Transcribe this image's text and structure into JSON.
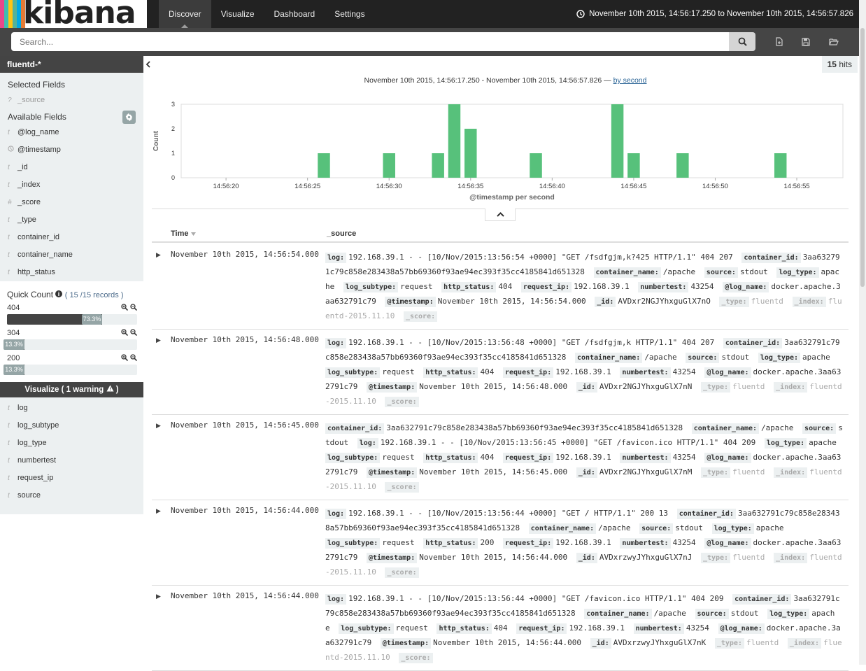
{
  "app": {
    "logo_text": "kibana",
    "logo_colors": [
      "#e8488b",
      "#3ebeb0",
      "#fec514",
      "#54b399",
      "#00a9e5",
      "#e57b36"
    ]
  },
  "nav": {
    "tabs": [
      {
        "label": "Discover",
        "active": true
      },
      {
        "label": "Visualize"
      },
      {
        "label": "Dashboard"
      },
      {
        "label": "Settings"
      }
    ]
  },
  "timerange": {
    "label": "November 10th 2015, 14:56:17.250 to November 10th 2015, 14:56:57.826"
  },
  "search": {
    "placeholder": "Search..."
  },
  "sidebar": {
    "index_pattern": "fluentd-*",
    "selected_title": "Selected Fields",
    "selected_fields": [
      {
        "type": "?",
        "name": "_source"
      }
    ],
    "available_title": "Available Fields",
    "fields_top": [
      {
        "type": "t",
        "name": "@log_name"
      },
      {
        "type": "clock",
        "name": "@timestamp"
      },
      {
        "type": "t",
        "name": "_id"
      },
      {
        "type": "t",
        "name": "_index"
      },
      {
        "type": "#",
        "name": "_score"
      },
      {
        "type": "t",
        "name": "_type"
      },
      {
        "type": "t",
        "name": "container_id"
      },
      {
        "type": "t",
        "name": "container_name"
      },
      {
        "type": "t",
        "name": "http_status"
      }
    ],
    "quick_count": {
      "title": "Quick Count",
      "count": "15",
      "total": "/15 records",
      "rows": [
        {
          "label": "404",
          "pct": "73.3%",
          "fraction": 0.733
        },
        {
          "label": "304",
          "pct": "13.3%",
          "fraction": 0.133
        },
        {
          "label": "200",
          "pct": "13.3%",
          "fraction": 0.133
        }
      ]
    },
    "visualize_btn": "Visualize ( 1 warning",
    "fields_bottom": [
      {
        "type": "t",
        "name": "log"
      },
      {
        "type": "t",
        "name": "log_subtype"
      },
      {
        "type": "t",
        "name": "log_type"
      },
      {
        "type": "t",
        "name": "numbertest"
      },
      {
        "type": "t",
        "name": "request_ip"
      },
      {
        "type": "t",
        "name": "source"
      }
    ]
  },
  "hits": {
    "count": "15",
    "label": "hits"
  },
  "chart_range": {
    "text": "November 10th 2015, 14:56:17.250 - November 10th 2015, 14:56:57.826 —",
    "link": "by second"
  },
  "chart_data": {
    "type": "bar",
    "xlabel": "@timestamp per second",
    "ylabel": "Count",
    "ylim": [
      0,
      3
    ],
    "yticks": [
      0,
      1,
      2,
      3
    ],
    "xticks": [
      {
        "label": "14:56:20",
        "t": 20
      },
      {
        "label": "14:56:25",
        "t": 25
      },
      {
        "label": "14:56:30",
        "t": 30
      },
      {
        "label": "14:56:35",
        "t": 35
      },
      {
        "label": "14:56:40",
        "t": 40
      },
      {
        "label": "14:56:45",
        "t": 45
      },
      {
        "label": "14:56:50",
        "t": 50
      },
      {
        "label": "14:56:55",
        "t": 55
      }
    ],
    "xlim": [
      17.25,
      57.83
    ],
    "bars": [
      {
        "t": 26,
        "v": 1
      },
      {
        "t": 30,
        "v": 1
      },
      {
        "t": 33,
        "v": 1
      },
      {
        "t": 34,
        "v": 3
      },
      {
        "t": 35,
        "v": 2
      },
      {
        "t": 39,
        "v": 1
      },
      {
        "t": 44,
        "v": 3
      },
      {
        "t": 45,
        "v": 1
      },
      {
        "t": 48,
        "v": 1
      },
      {
        "t": 54,
        "v": 1
      }
    ],
    "bar_color": "#57c17b"
  },
  "table": {
    "headers": {
      "time": "Time",
      "source": "_source"
    },
    "rows": [
      {
        "time": "November 10th 2015, 14:56:54.000",
        "fields": [
          [
            "log:",
            "192.168.39.1 - - [10/Nov/2015:13:56:54 +0000] \"GET /fsdfgjm,k?425 HTTP/1.1\" 404 207"
          ],
          [
            "container_id:",
            "3aa632791c79c858e283438a57bb69360f93ae94ec393f35cc4185841d651328"
          ],
          [
            "container_name:",
            "/apache"
          ],
          [
            "source:",
            "stdout"
          ],
          [
            "log_type:",
            "apache"
          ],
          [
            "log_subtype:",
            "request"
          ],
          [
            "http_status:",
            "404"
          ],
          [
            "request_ip:",
            "192.168.39.1"
          ],
          [
            "numbertest:",
            "43254"
          ],
          [
            "@log_name:",
            "docker.apache.3aa632791c79"
          ],
          [
            "@timestamp:",
            "November 10th 2015, 14:56:54.000"
          ],
          [
            "_id:",
            "AVDxr2NGJYhxguGlX7nO"
          ],
          [
            "_type:",
            "fluentd"
          ],
          [
            "_index:",
            "fluentd-2015.11.10"
          ],
          [
            "_score:",
            ""
          ]
        ]
      },
      {
        "time": "November 10th 2015, 14:56:48.000",
        "fields": [
          [
            "log:",
            "192.168.39.1 - - [10/Nov/2015:13:56:48 +0000] \"GET /fsdfgjm,k HTTP/1.1\" 404 207"
          ],
          [
            "container_id:",
            "3aa632791c79c858e283438a57bb69360f93ae94ec393f35cc4185841d651328"
          ],
          [
            "container_name:",
            "/apache"
          ],
          [
            "source:",
            "stdout"
          ],
          [
            "log_type:",
            "apache"
          ],
          [
            "log_subtype:",
            "request"
          ],
          [
            "http_status:",
            "404"
          ],
          [
            "request_ip:",
            "192.168.39.1"
          ],
          [
            "numbertest:",
            "43254"
          ],
          [
            "@log_name:",
            "docker.apache.3aa632791c79"
          ],
          [
            "@timestamp:",
            "November 10th 2015, 14:56:48.000"
          ],
          [
            "_id:",
            "AVDxr2NGJYhxguGlX7nN"
          ],
          [
            "_type:",
            "fluentd"
          ],
          [
            "_index:",
            "fluentd-2015.11.10"
          ],
          [
            "_score:",
            ""
          ]
        ]
      },
      {
        "time": "November 10th 2015, 14:56:45.000",
        "fields": [
          [
            "container_id:",
            "3aa632791c79c858e283438a57bb69360f93ae94ec393f35cc4185841d651328"
          ],
          [
            "container_name:",
            "/apache"
          ],
          [
            "source:",
            "stdout"
          ],
          [
            "log:",
            "192.168.39.1 - - [10/Nov/2015:13:56:45 +0000] \"GET /favicon.ico HTTP/1.1\" 404 209"
          ],
          [
            "log_type:",
            "apache"
          ],
          [
            "log_subtype:",
            "request"
          ],
          [
            "http_status:",
            "404"
          ],
          [
            "request_ip:",
            "192.168.39.1"
          ],
          [
            "numbertest:",
            "43254"
          ],
          [
            "@log_name:",
            "docker.apache.3aa632791c79"
          ],
          [
            "@timestamp:",
            "November 10th 2015, 14:56:45.000"
          ],
          [
            "_id:",
            "AVDxr2NGJYhxguGlX7nM"
          ],
          [
            "_type:",
            "fluentd"
          ],
          [
            "_index:",
            "fluentd-2015.11.10"
          ],
          [
            "_score:",
            ""
          ]
        ]
      },
      {
        "time": "November 10th 2015, 14:56:44.000",
        "fields": [
          [
            "log:",
            "192.168.39.1 - - [10/Nov/2015:13:56:44 +0000] \"GET / HTTP/1.1\" 200 13"
          ],
          [
            "container_id:",
            "3aa632791c79c858e283438a57bb69360f93ae94ec393f35cc4185841d651328"
          ],
          [
            "container_name:",
            "/apache"
          ],
          [
            "source:",
            "stdout"
          ],
          [
            "log_type:",
            "apache"
          ],
          [
            "log_subtype:",
            "request"
          ],
          [
            "http_status:",
            "200"
          ],
          [
            "request_ip:",
            "192.168.39.1"
          ],
          [
            "numbertest:",
            "43254"
          ],
          [
            "@log_name:",
            "docker.apache.3aa632791c79"
          ],
          [
            "@timestamp:",
            "November 10th 2015, 14:56:44.000"
          ],
          [
            "_id:",
            "AVDxrzwyJYhxguGlX7nJ"
          ],
          [
            "_type:",
            "fluentd"
          ],
          [
            "_index:",
            "fluentd-2015.11.10"
          ],
          [
            "_score:",
            ""
          ]
        ]
      },
      {
        "time": "November 10th 2015, 14:56:44.000",
        "fields": [
          [
            "log:",
            "192.168.39.1 - - [10/Nov/2015:13:56:44 +0000] \"GET /favicon.ico HTTP/1.1\" 404 209"
          ],
          [
            "container_id:",
            "3aa632791c79c858e283438a57bb69360f93ae94ec393f35cc4185841d651328"
          ],
          [
            "container_name:",
            "/apache"
          ],
          [
            "source:",
            "stdout"
          ],
          [
            "log_type:",
            "apache"
          ],
          [
            "log_subtype:",
            "request"
          ],
          [
            "http_status:",
            "404"
          ],
          [
            "request_ip:",
            "192.168.39.1"
          ],
          [
            "numbertest:",
            "43254"
          ],
          [
            "@log_name:",
            "docker.apache.3aa632791c79"
          ],
          [
            "@timestamp:",
            "November 10th 2015, 14:56:44.000"
          ],
          [
            "_id:",
            "AVDxrzwyJYhxguGlX7nK"
          ],
          [
            "_type:",
            "fluentd"
          ],
          [
            "_index:",
            "fluentd-2015.11.10"
          ],
          [
            "_score:",
            ""
          ]
        ]
      }
    ]
  }
}
